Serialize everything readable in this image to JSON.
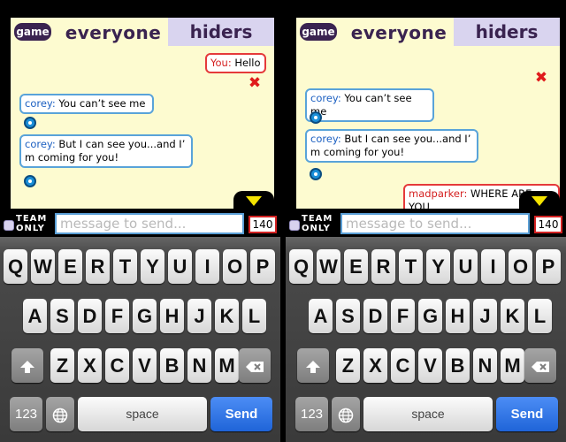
{
  "screens": [
    {
      "tabs": {
        "game": "game",
        "everyone": "everyone",
        "hiders": "hiders"
      },
      "messages": [
        {
          "sender": "You:",
          "text": " Hello"
        },
        {
          "sender": "corey:",
          "text": " You can’t see me"
        },
        {
          "sender": "corey:",
          "text1": " But I can see you...and I’",
          "text2": "m coming for you!"
        }
      ],
      "team_label": {
        "line1": "TEAM",
        "line2": "ONLY"
      },
      "input": {
        "placeholder": "message to send..."
      },
      "counter": "140"
    },
    {
      "tabs": {
        "game": "game",
        "everyone": "everyone",
        "hiders": "hiders"
      },
      "messages": [
        {
          "sender": "corey:",
          "text": " You can’t see me"
        },
        {
          "sender": "corey:",
          "text1": " But I can see you...and I’",
          "text2": "m coming for you!"
        },
        {
          "sender": "madparker:",
          "text": " WHERE ARE YOU"
        }
      ],
      "team_label": {
        "line1": "TEAM",
        "line2": "ONLY"
      },
      "input": {
        "placeholder": "message to send..."
      },
      "counter": "140"
    }
  ],
  "keyboard": {
    "row1": [
      "Q",
      "W",
      "E",
      "R",
      "T",
      "Y",
      "U",
      "I",
      "O",
      "P"
    ],
    "row2": [
      "A",
      "S",
      "D",
      "F",
      "G",
      "H",
      "J",
      "K",
      "L"
    ],
    "row3": [
      "Z",
      "X",
      "C",
      "V",
      "B",
      "N",
      "M"
    ],
    "numbers": "123",
    "space": "space",
    "send": "Send"
  },
  "colors": {
    "chat_bg": "#fdfbd0",
    "tab_dark": "#3a2350",
    "tab_light": "#d9d4ef",
    "bubble_border": "#59a3d9",
    "bubble_border_self": "#e53a3a",
    "send_key": "#1f64d8",
    "arrow": "#f5e400"
  },
  "icons": {
    "delete": "x-mark-icon",
    "pin": "location-pin-icon",
    "shift": "shift-arrow-icon",
    "globe": "globe-icon",
    "backspace": "backspace-icon",
    "expand": "triangle-down-icon"
  }
}
